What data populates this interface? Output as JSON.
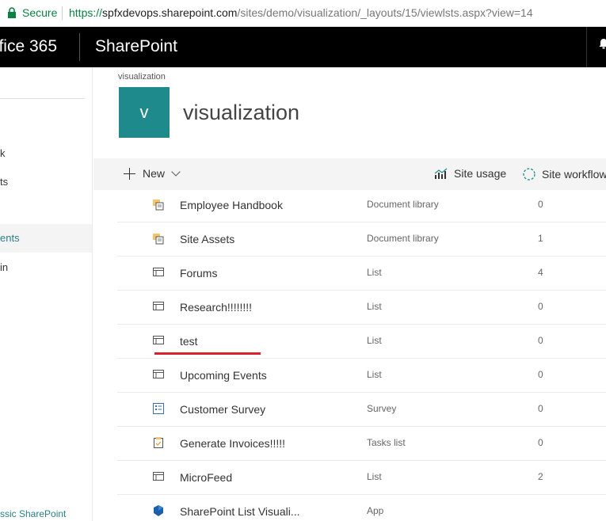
{
  "browser": {
    "secure_label": "Secure",
    "url_proto": "https://",
    "url_host": "spfxdevops.sharepoint.com",
    "url_path": "/sites/demo/visualization/_layouts/15/viewlsts.aspx?view=14"
  },
  "suitebar": {
    "app_launcher_label": "ffice 365",
    "product_label": "SharePoint"
  },
  "leftnav": {
    "items": [
      {
        "label": "k"
      },
      {
        "label": "ts"
      },
      {
        "label": "ents"
      },
      {
        "label": "in"
      }
    ],
    "bottom_link": "ssic SharePoint"
  },
  "site": {
    "breadcrumb": "visualization",
    "logo_letter": "v",
    "title": "visualization"
  },
  "commandbar": {
    "new_label": "New",
    "site_usage_label": "Site usage",
    "site_workflows_label": "Site workflow"
  },
  "contents": [
    {
      "name": "Employee Handbook",
      "type": "Document library",
      "count": "0",
      "icon": "document-library-icon"
    },
    {
      "name": "Site Assets",
      "type": "Document library",
      "count": "1",
      "icon": "document-library-icon"
    },
    {
      "name": "Forums",
      "type": "List",
      "count": "4",
      "icon": "list-icon"
    },
    {
      "name": "Research!!!!!!!!",
      "type": "List",
      "count": "0",
      "icon": "list-icon"
    },
    {
      "name": "test",
      "type": "List",
      "count": "0",
      "icon": "list-icon"
    },
    {
      "name": "Upcoming Events",
      "type": "List",
      "count": "0",
      "icon": "list-icon"
    },
    {
      "name": "Customer Survey",
      "type": "Survey",
      "count": "0",
      "icon": "survey-icon"
    },
    {
      "name": "Generate Invoices!!!!!",
      "type": "Tasks list",
      "count": "0",
      "icon": "tasks-list-icon"
    },
    {
      "name": "MicroFeed",
      "type": "List",
      "count": "2",
      "icon": "list-icon"
    },
    {
      "name": "SharePoint List Visuali...",
      "type": "App",
      "count": "",
      "icon": "app-icon"
    }
  ],
  "colors": {
    "accent": "#1e8a8c",
    "highlight_underline": "#d9202c",
    "suitebar_bg": "#000000"
  }
}
